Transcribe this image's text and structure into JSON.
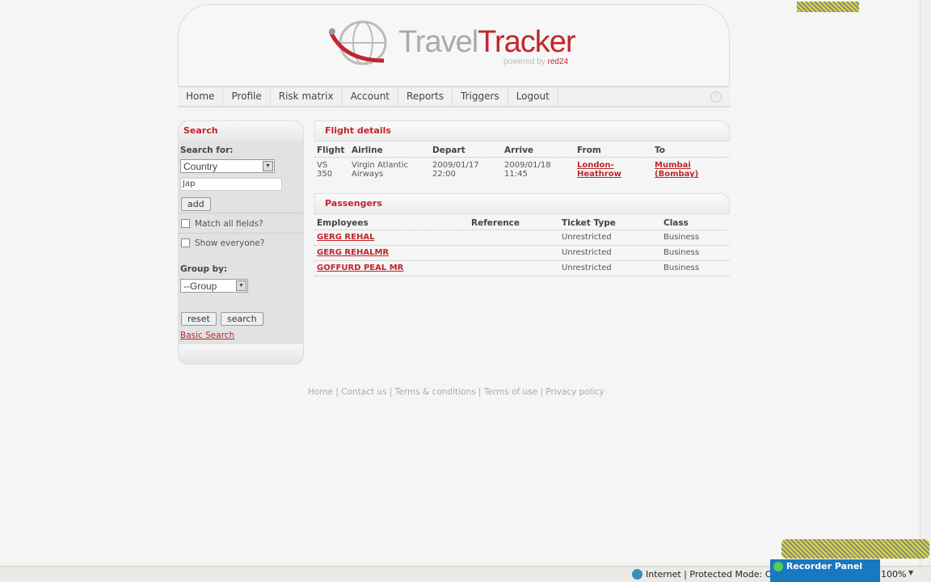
{
  "logo": {
    "travel": "Travel",
    "tracker": "Tracker",
    "powered": "powered by",
    "brand": "red24"
  },
  "nav": [
    "Home",
    "Profile",
    "Risk matrix",
    "Account",
    "Reports",
    "Triggers",
    "Logout"
  ],
  "search": {
    "title": "Search",
    "search_for": "Search for:",
    "field_select": "Country",
    "input_value": "Jap",
    "add": "add",
    "match_all": "Match all fields?",
    "show_everyone": "Show everyone?",
    "group_by": "Group by:",
    "group_select": "--Group",
    "reset": "reset",
    "search": "search",
    "basic_search": "Basic Search"
  },
  "flight": {
    "title": "Flight details",
    "headers": [
      "Flight",
      "Airline",
      "Depart",
      "Arrive",
      "From",
      "To"
    ],
    "row": {
      "flight": [
        "VS",
        "350"
      ],
      "airline": [
        "Virgin Atlantic",
        "Airways"
      ],
      "depart": [
        "2009/01/17",
        "22:00"
      ],
      "arrive": [
        "2009/01/18",
        "11:45"
      ],
      "from": [
        "London-",
        "Heathrow"
      ],
      "to": [
        "Mumbai",
        "(Bombay)"
      ]
    }
  },
  "passengers": {
    "title": "Passengers",
    "headers": [
      "Employees",
      "Reference",
      "Ticket Type",
      "Class"
    ],
    "rows": [
      {
        "name": "GERG REHAL",
        "ref": "",
        "ticket": "Unrestricted",
        "class": "Business"
      },
      {
        "name": "GERG REHALMR",
        "ref": "",
        "ticket": "Unrestricted",
        "class": "Business"
      },
      {
        "name": "GOFFURD PEAL MR",
        "ref": "",
        "ticket": "Unrestricted",
        "class": "Business"
      }
    ]
  },
  "footer": [
    "Home",
    "Contact us",
    "Terms & conditions",
    "Terms of use",
    "Privacy policy"
  ],
  "status": {
    "zone": "Internet | Protected Mode: On",
    "zoom": "100%"
  },
  "recorder": {
    "title": "Recorder Panel"
  },
  "colors": {
    "accent": "#c0272d"
  }
}
